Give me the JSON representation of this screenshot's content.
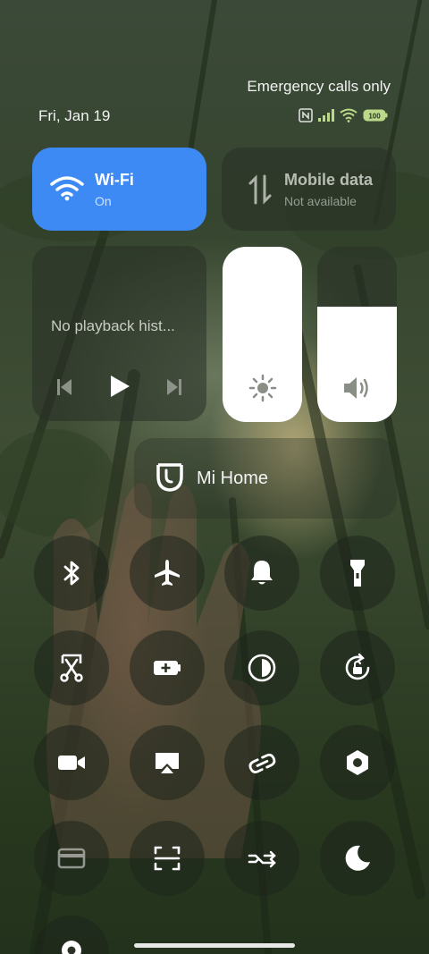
{
  "status": {
    "carrier_text": "Emergency calls only",
    "date": "Fri, Jan 19",
    "battery": "100"
  },
  "tiles": {
    "wifi": {
      "title": "Wi-Fi",
      "subtitle": "On"
    },
    "mobile": {
      "title": "Mobile data",
      "subtitle": "Not available"
    }
  },
  "media": {
    "text": "No playback hist..."
  },
  "sliders": {
    "brightness": 1.0,
    "volume": 0.66
  },
  "mi_home": {
    "label": "Mi Home"
  },
  "toggles": [
    "bluetooth-icon",
    "airplane-icon",
    "bell-icon",
    "flashlight-icon",
    "screenshot-scissors-icon",
    "battery-saver-icon",
    "reading-mode-icon",
    "rotation-lock-icon",
    "video-camera-icon",
    "cast-icon",
    "link-icon",
    "hexagon-settings-icon",
    "card-icon",
    "scan-icon",
    "sync-icon",
    "moon-icon",
    "location-icon"
  ],
  "colors": {
    "wifi_active": "#3d8af5",
    "tile_bg": "#2b3329"
  }
}
